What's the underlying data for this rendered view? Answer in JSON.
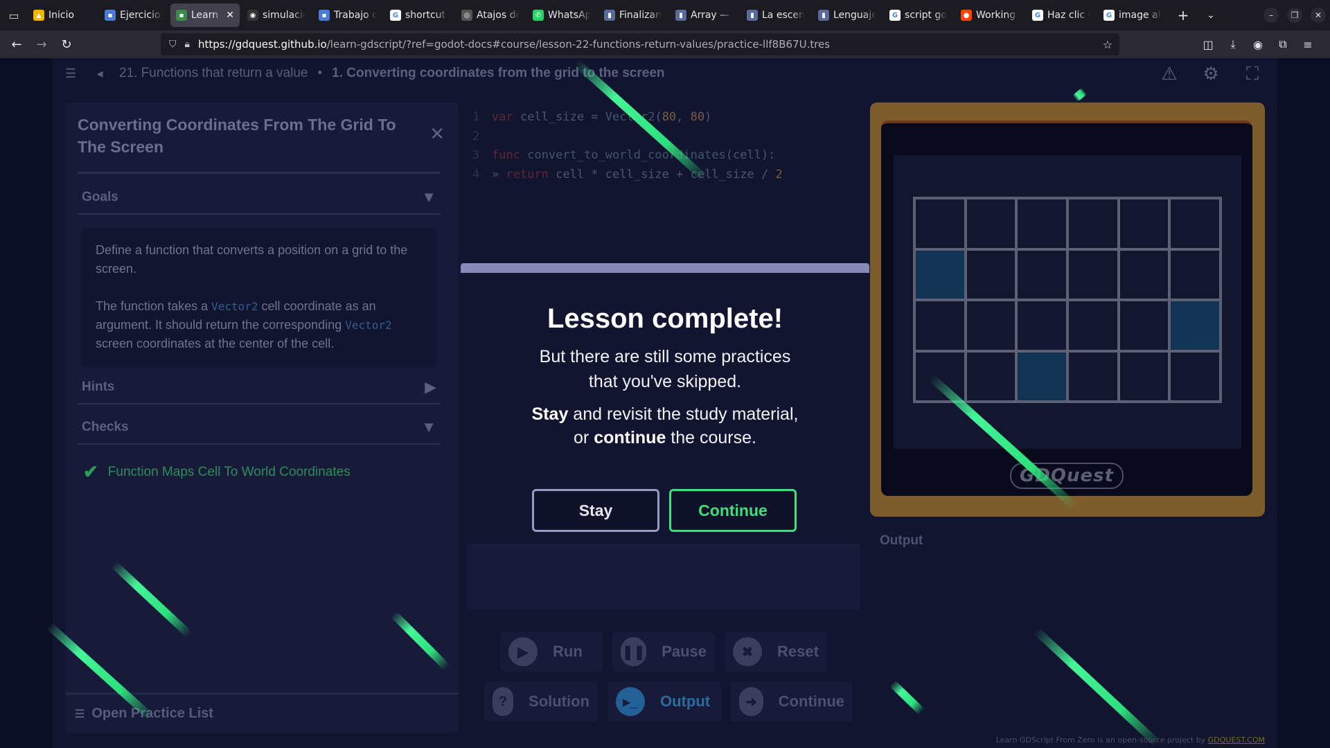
{
  "browser": {
    "tabs": [
      {
        "label": "Inicio",
        "color": "#f5b400",
        "glyph": "▲"
      },
      {
        "label": "Ejercicios",
        "color": "#4a7bd8",
        "glyph": "▪"
      },
      {
        "label": "Learn",
        "color": "#3a8a4a",
        "glyph": "▪",
        "active": true
      },
      {
        "label": "simulacio",
        "color": "#333",
        "glyph": "◉"
      },
      {
        "label": "Trabajo d",
        "color": "#4a7bd8",
        "glyph": "▪"
      },
      {
        "label": "shortcut",
        "color": "#fff",
        "glyph": "G"
      },
      {
        "label": "Atajos de",
        "color": "#555",
        "glyph": "◎"
      },
      {
        "label": "WhatsAp",
        "color": "#25d366",
        "glyph": "✆"
      },
      {
        "label": "Finalizan",
        "color": "#5a6a9a",
        "glyph": "▮"
      },
      {
        "label": "Array — l",
        "color": "#5a6a9a",
        "glyph": "▮"
      },
      {
        "label": "La escen",
        "color": "#5a6a9a",
        "glyph": "▮"
      },
      {
        "label": "Lenguaje",
        "color": "#5a6a9a",
        "glyph": "▮"
      },
      {
        "label": "script go",
        "color": "#fff",
        "glyph": "G"
      },
      {
        "label": "Working",
        "color": "#ff4500",
        "glyph": "●"
      },
      {
        "label": "Haz clic e",
        "color": "#fff",
        "glyph": "G"
      },
      {
        "label": "image all",
        "color": "#fff",
        "glyph": "G"
      }
    ],
    "url_host": "https://gdquest.github.io",
    "url_rest": "/learn-gdscript/?ref=godot-docs#course/lesson-22-functions-return-values/practice-llf8B67U.tres"
  },
  "header": {
    "lesson": "21. Functions that return a value",
    "separator": "•",
    "practice": "1. Converting coordinates from the grid to the screen"
  },
  "panel": {
    "title": "Converting Coordinates From The Grid To The Screen",
    "goals_label": "Goals",
    "goal_p1": "Define a function that converts a position on a grid to the screen.",
    "goal_p2_a": "The function takes a ",
    "goal_code1": "Vector2",
    "goal_p2_b": " cell coordinate as an argument. It should return the corresponding ",
    "goal_code2": "Vector2",
    "goal_p2_c": " screen coordinates at the center of the cell.",
    "hints_label": "Hints",
    "checks_label": "Checks",
    "check1": "Function Maps Cell To World Coordinates",
    "footer": "Open Practice List"
  },
  "editor": {
    "lines": [
      {
        "n": "1"
      },
      {
        "n": "2"
      },
      {
        "n": "3"
      },
      {
        "n": "4"
      }
    ],
    "l1_kw": "var",
    "l1_a": " cell_size = ",
    "l1_fn": "Vector2",
    "l1_p1": "(",
    "l1_n1": "80",
    "l1_p2": ", ",
    "l1_n2": "80",
    "l1_p3": ")",
    "l3_kw": "func",
    "l3_fn": " convert_to_world_coordinates",
    "l3_a": "(cell):",
    "l4_tab": "» ",
    "l4_kw": "return",
    "l4_a": " cell * cell_size + cell_size / ",
    "l4_n": "2"
  },
  "controls": {
    "run": "Run",
    "pause": "Pause",
    "reset": "Reset",
    "solution": "Solution",
    "output": "Output",
    "continue": "Continue"
  },
  "viewport": {
    "logo": "GDQuest",
    "highlighted_cells": [
      [
        1,
        0
      ],
      [
        2,
        5
      ],
      [
        3,
        2
      ]
    ]
  },
  "output": {
    "title": "Output"
  },
  "credit": {
    "text": "Learn GDScript From Zero is an open-source project by ",
    "link": "GDQUEST.COM"
  },
  "modal": {
    "title": "Lesson complete!",
    "line1": "But there are still some practices",
    "line2": "that you've skipped.",
    "stay_word": "Stay",
    "body_a": " and revisit the study material,",
    "body_b": "or ",
    "continue_word": "continue",
    "body_c": " the course.",
    "stay_btn": "Stay",
    "continue_btn": "Continue"
  }
}
